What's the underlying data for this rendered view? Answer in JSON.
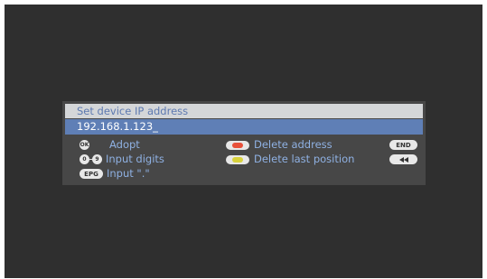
{
  "dialog": {
    "title": "Set device IP address",
    "ip_value": "192.168.1.123_"
  },
  "hints": [
    {
      "key": "OK",
      "label": "Adopt"
    },
    {
      "key": "0-9",
      "label": "Input digits"
    },
    {
      "key": "EPG",
      "label": "Input \".\""
    },
    {
      "key": "red",
      "label": "Delete address",
      "color": "#e8503a"
    },
    {
      "key": "yellow",
      "label": "Delete last position",
      "color": "#d8d23c"
    }
  ],
  "right_keys": {
    "end": "END"
  }
}
